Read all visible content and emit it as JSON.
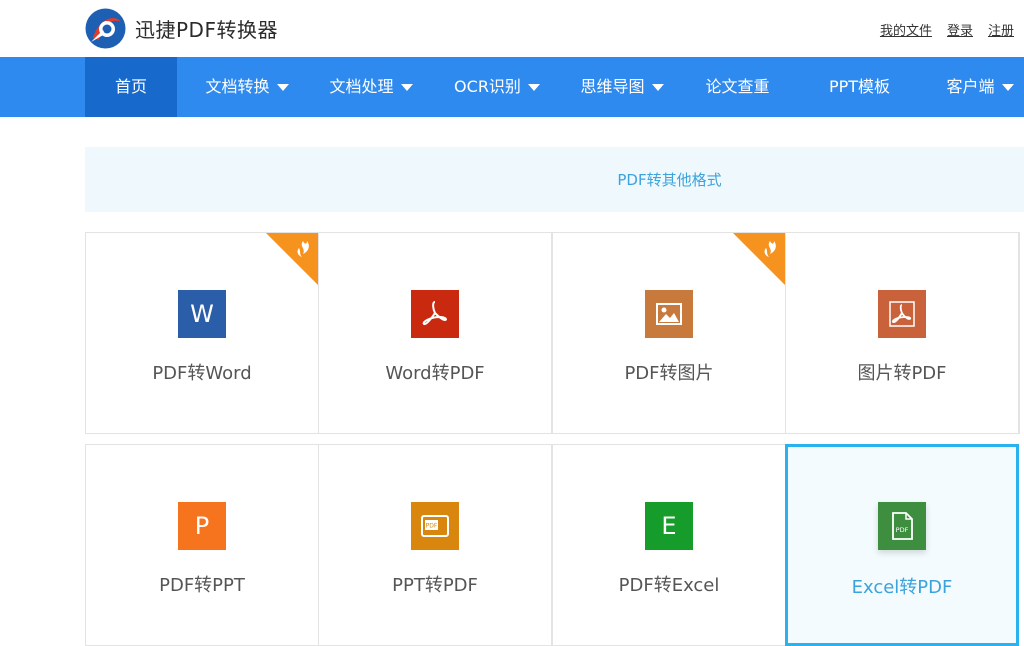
{
  "header": {
    "logo_text": "迅捷PDF转换器",
    "links": [
      "我的文件",
      "登录",
      "注册"
    ]
  },
  "nav": {
    "items": [
      {
        "label": "首页",
        "dropdown": false,
        "active": true
      },
      {
        "label": "文档转换",
        "dropdown": true
      },
      {
        "label": "文档处理",
        "dropdown": true
      },
      {
        "label": "OCR识别",
        "dropdown": true
      },
      {
        "label": "思维导图",
        "dropdown": true
      },
      {
        "label": "论文查重",
        "dropdown": false
      },
      {
        "label": "PPT模板",
        "dropdown": false
      },
      {
        "label": "客户端",
        "dropdown": true
      }
    ]
  },
  "section": {
    "title": "PDF转其他格式"
  },
  "tools": [
    {
      "label": "PDF转Word",
      "icon": "word-icon",
      "glyph": "W",
      "color": "#2a5ea8",
      "hot": true
    },
    {
      "label": "Word转PDF",
      "icon": "pdf-icon",
      "glyph": "",
      "color": "#c8290f",
      "hot": false
    },
    {
      "label": "PDF转图片",
      "icon": "image-icon",
      "glyph": "",
      "color": "#c77a3c",
      "hot": true
    },
    {
      "label": "图片转PDF",
      "icon": "pdf-icon",
      "glyph": "",
      "color": "#c9623a",
      "hot": false
    },
    {
      "label": "PDF转PPT",
      "icon": "ppt-icon",
      "glyph": "P",
      "color": "#f7741e",
      "hot": false
    },
    {
      "label": "PPT转PDF",
      "icon": "ppt-pdf-icon",
      "glyph": "",
      "color": "#d9860e",
      "hot": false
    },
    {
      "label": "PDF转Excel",
      "icon": "excel-icon",
      "glyph": "E",
      "color": "#159c2a",
      "hot": false
    },
    {
      "label": "Excel转PDF",
      "icon": "pdf-doc-icon",
      "glyph": "",
      "color": "#3d8f3f",
      "hot": false,
      "selected": true
    }
  ],
  "colors": {
    "nav_bg": "#2f8af0",
    "nav_active": "#1769cc",
    "section_bg": "#eef8fd",
    "section_text": "#3da3dc",
    "hot_badge": "#f6921e",
    "selected_border": "#2ab1f0"
  }
}
